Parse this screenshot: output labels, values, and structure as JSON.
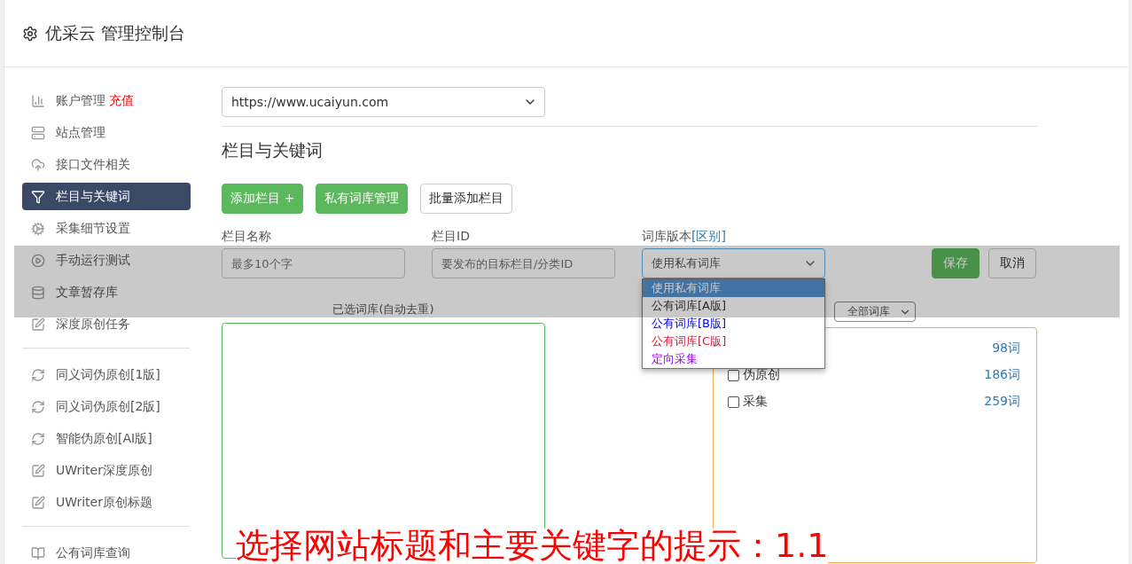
{
  "header": {
    "title": "优采云 管理控制台"
  },
  "sidebar": {
    "groups": [
      [
        {
          "kind": "chart",
          "label": "账户管理",
          "badge": "充值",
          "selected": false
        },
        {
          "kind": "server",
          "label": "站点管理",
          "selected": false
        },
        {
          "kind": "cloud",
          "label": "接口文件相关",
          "selected": false
        },
        {
          "kind": "filter",
          "label": "栏目与关键词",
          "selected": true
        },
        {
          "kind": "cogs",
          "label": "采集细节设置",
          "selected": false
        },
        {
          "kind": "play",
          "label": "手动运行测试",
          "selected": false
        },
        {
          "kind": "database",
          "label": "文章暂存库",
          "selected": false
        },
        {
          "kind": "edit",
          "label": "深度原创任务",
          "selected": false
        }
      ],
      [
        {
          "kind": "refresh",
          "label": "同义词伪原创[1版]",
          "selected": false
        },
        {
          "kind": "refresh",
          "label": "同义词伪原创[2版]",
          "selected": false
        },
        {
          "kind": "refresh",
          "label": "智能伪原创[AI版]",
          "selected": false
        },
        {
          "kind": "edit",
          "label": "UWriter深度原创",
          "selected": false
        },
        {
          "kind": "edit",
          "label": "UWriter原创标题",
          "selected": false
        }
      ],
      [
        {
          "kind": "book",
          "label": "公有词库查询",
          "selected": false
        }
      ]
    ]
  },
  "site_select": {
    "value": "https://www.ucaiyun.com"
  },
  "section_title": "栏目与关键词",
  "buttons": [
    {
      "kind": "primary",
      "label": "添加栏目 +"
    },
    {
      "kind": "primary",
      "label": "私有词库管理"
    },
    {
      "kind": "outline",
      "label": "批量添加栏目"
    }
  ],
  "form": {
    "name": {
      "label": "栏目名称",
      "placeholder": "最多10个字"
    },
    "id": {
      "label": "栏目ID",
      "placeholder": "要发布的目标栏目/分类ID"
    },
    "library": {
      "label": "词库版本",
      "link": "[区别]",
      "value": "使用私有词库",
      "options": [
        {
          "label": "使用私有词库",
          "selected": true
        },
        {
          "label": "公有词库[A版]",
          "selected": false,
          "color": "#333333"
        },
        {
          "label": "公有词库[B版]",
          "selected": false,
          "color": "#0000ff"
        },
        {
          "label": "公有词库[C版]",
          "selected": false,
          "color": "#dc143c"
        },
        {
          "label": "定向采集",
          "selected": false,
          "color": "#9900ff"
        }
      ]
    },
    "save": "保存",
    "cancel": "取消"
  },
  "selected_panel": {
    "title": "已选词库(自动去重)"
  },
  "library_panel": {
    "filter": "全部词库",
    "rows": [
      {
        "count": "98词"
      },
      {
        "label": "伪原创",
        "count": "186词",
        "checked": false
      },
      {
        "label": "采集",
        "count": "259词",
        "checked": false
      }
    ]
  },
  "caption": "选择网站标题和主要关键字的提示：1.1"
}
